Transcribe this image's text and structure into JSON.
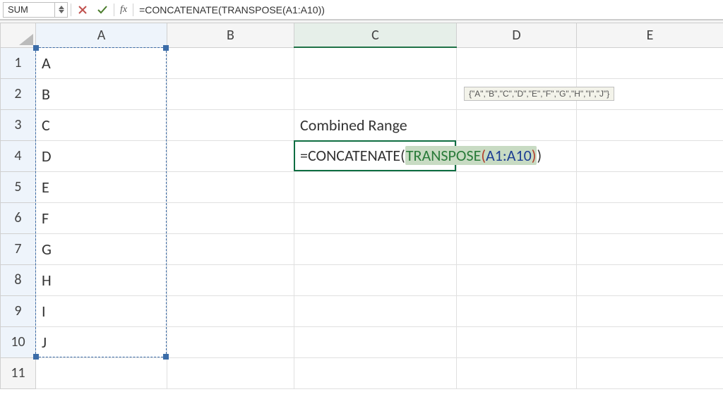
{
  "formulaBar": {
    "nameBoxValue": "SUM",
    "fxLabel": "fx",
    "formulaText": "=CONCATENATE(TRANSPOSE(A1:A10))"
  },
  "columns": [
    "A",
    "B",
    "C",
    "D",
    "E"
  ],
  "rows": [
    "1",
    "2",
    "3",
    "4",
    "5",
    "6",
    "7",
    "8",
    "9",
    "10",
    "11"
  ],
  "cells": {
    "A1": "A",
    "A2": "B",
    "A3": "C",
    "A4": "D",
    "A5": "E",
    "A6": "F",
    "A7": "G",
    "A8": "H",
    "A9": "I",
    "A10": "J",
    "C3": "Combined Range"
  },
  "edit": {
    "eq": "=",
    "concat": "CONCATENATE",
    "open1": "(",
    "trans": "TRANSPOSE",
    "open2": "(",
    "range": "A1:A10",
    "close2": ")",
    "close1": ")"
  },
  "tooltip": "{\"A\",\"B\",\"C\",\"D\",\"E\",\"F\",\"G\",\"H\",\"I\",\"J\"}",
  "colWidths": {
    "rowHdr": 50,
    "A": 186,
    "B": 180,
    "C": 230,
    "D": 170,
    "E": 208
  }
}
